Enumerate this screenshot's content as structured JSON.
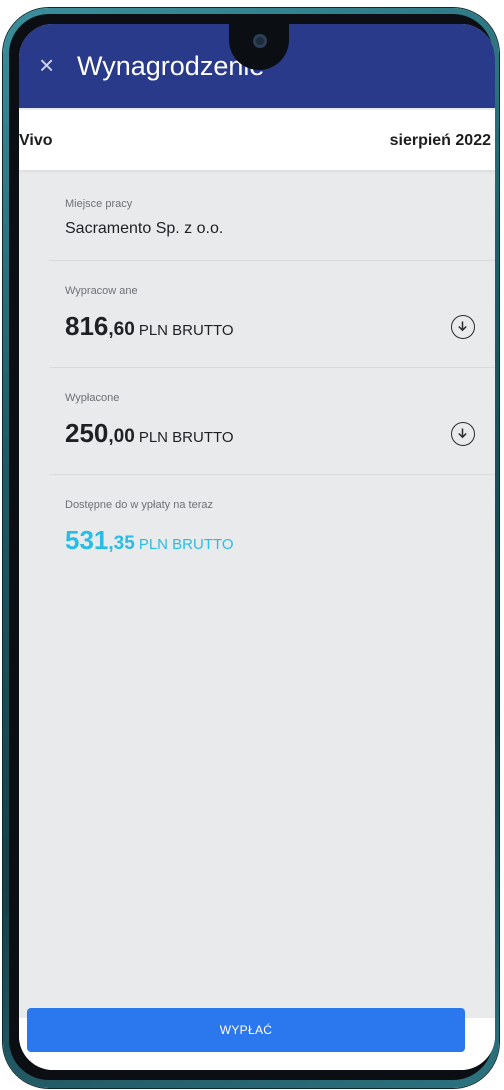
{
  "app": {
    "title": "Wynagrodzenie"
  },
  "header": {
    "employer_short": "Vivo",
    "period": "sierpień 2022"
  },
  "workplace": {
    "label": "Miejsce pracy",
    "value": "Sacramento Sp. z o.o."
  },
  "worked": {
    "label": "Wypracow ane",
    "amount_int": "816",
    "amount_dec": ",60",
    "unit": "PLN BRUTTO"
  },
  "paid": {
    "label": "Wypłacone",
    "amount_int": "250",
    "amount_dec": ",00",
    "unit": "PLN BRUTTO"
  },
  "available": {
    "label": "Dostępne do w ypłaty na teraz",
    "amount_int": "531",
    "amount_dec": ",35",
    "unit": "PLN BRUTTO"
  },
  "actions": {
    "withdraw_label": "WYPŁAĆ"
  },
  "colors": {
    "appbar": "#283a89",
    "accent": "#28bde6",
    "button": "#2b78ee"
  },
  "icons": {
    "close": "close-icon",
    "download": "download-icon"
  }
}
